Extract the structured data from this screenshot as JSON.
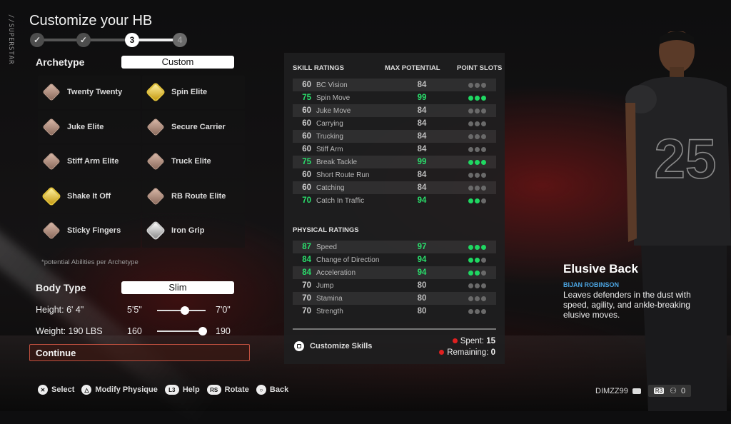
{
  "side_tag": "//SUPERSTAR",
  "header": {
    "title": "Customize your HB"
  },
  "stepper": {
    "steps": [
      {
        "label": "✓",
        "state": "done"
      },
      {
        "label": "✓",
        "state": "done"
      },
      {
        "label": "3",
        "state": "current"
      },
      {
        "label": "4",
        "state": "future"
      }
    ]
  },
  "archetype": {
    "label": "Archetype",
    "value": "Custom"
  },
  "abilities": [
    {
      "name": "Twenty Twenty",
      "tier": "bronze"
    },
    {
      "name": "Spin Elite",
      "tier": "gold"
    },
    {
      "name": "Juke Elite",
      "tier": "bronze"
    },
    {
      "name": "Secure Carrier",
      "tier": "bronze"
    },
    {
      "name": "Stiff Arm Elite",
      "tier": "bronze"
    },
    {
      "name": "Truck Elite",
      "tier": "bronze"
    },
    {
      "name": "Shake It Off",
      "tier": "gold"
    },
    {
      "name": "RB Route Elite",
      "tier": "bronze"
    },
    {
      "name": "Sticky Fingers",
      "tier": "bronze"
    },
    {
      "name": "Iron Grip",
      "tier": "silver"
    }
  ],
  "footnote": "*potential Abilities per Archetype",
  "body_type": {
    "label": "Body Type",
    "value": "Slim"
  },
  "height": {
    "label": "Height: 6' 4\"",
    "min": "5'5\"",
    "max": "7'0\"",
    "fraction": 0.57
  },
  "weight": {
    "label": "Weight: 190 LBS",
    "min": "160",
    "max": "190",
    "fraction": 1.0
  },
  "continue_label": "Continue",
  "ratings": {
    "skill_header": "SKILL RATINGS",
    "max_header": "MAX POTENTIAL",
    "slots_header": "POINT SLOTS",
    "skill": [
      {
        "current": "60",
        "name": "BC Vision",
        "max": "84",
        "slots": 0,
        "highlight": false
      },
      {
        "current": "75",
        "name": "Spin Move",
        "max": "99",
        "slots": 3,
        "highlight": true
      },
      {
        "current": "60",
        "name": "Juke Move",
        "max": "84",
        "slots": 0,
        "highlight": false
      },
      {
        "current": "60",
        "name": "Carrying",
        "max": "84",
        "slots": 0,
        "highlight": false
      },
      {
        "current": "60",
        "name": "Trucking",
        "max": "84",
        "slots": 0,
        "highlight": false
      },
      {
        "current": "60",
        "name": "Stiff Arm",
        "max": "84",
        "slots": 0,
        "highlight": false
      },
      {
        "current": "75",
        "name": "Break Tackle",
        "max": "99",
        "slots": 3,
        "highlight": true
      },
      {
        "current": "60",
        "name": "Short Route Run",
        "max": "84",
        "slots": 0,
        "highlight": false
      },
      {
        "current": "60",
        "name": "Catching",
        "max": "84",
        "slots": 0,
        "highlight": false
      },
      {
        "current": "70",
        "name": "Catch In Traffic",
        "max": "94",
        "slots": 2,
        "highlight": true
      }
    ],
    "physical_header": "PHYSICAL RATINGS",
    "physical": [
      {
        "current": "87",
        "name": "Speed",
        "max": "97",
        "slots": 3,
        "highlight": true
      },
      {
        "current": "84",
        "name": "Change of Direction",
        "max": "94",
        "slots": 2,
        "highlight": true
      },
      {
        "current": "84",
        "name": "Acceleration",
        "max": "94",
        "slots": 2,
        "highlight": true
      },
      {
        "current": "70",
        "name": "Jump",
        "max": "80",
        "slots": 0,
        "highlight": false
      },
      {
        "current": "70",
        "name": "Stamina",
        "max": "80",
        "slots": 0,
        "highlight": false
      },
      {
        "current": "70",
        "name": "Strength",
        "max": "80",
        "slots": 0,
        "highlight": false
      }
    ],
    "customize_label": "Customize Skills",
    "spent_label": "Spent:",
    "spent_value": "15",
    "remaining_label": "Remaining:",
    "remaining_value": "0"
  },
  "archetype_info": {
    "title": "Elusive Back",
    "player": "BIJAN ROBINSON",
    "description": "Leaves defenders in the dust with speed, agility, and ankle-breaking elusive moves."
  },
  "player_model": {
    "jersey_number": "25"
  },
  "hints": [
    {
      "button": "✕",
      "label": "Select",
      "icon": "cross-button-icon"
    },
    {
      "button": "△",
      "label": "Modify Physique",
      "icon": "triangle-button-icon"
    },
    {
      "button": "L3",
      "label": "Help",
      "icon": "l3-button-icon"
    },
    {
      "button": "RS",
      "label": "Rotate",
      "icon": "rs-button-icon"
    },
    {
      "button": "○",
      "label": "Back",
      "icon": "circle-button-icon"
    }
  ],
  "user": {
    "name": "DIMZZ99",
    "party_button": "R3",
    "party_count": "0"
  },
  "colors": {
    "highlight_green": "#2adf6c",
    "slot_green": "#1fd862",
    "continue_border": "#c0503f",
    "player_blue": "#4ba3e0",
    "status_red": "#e02020"
  }
}
